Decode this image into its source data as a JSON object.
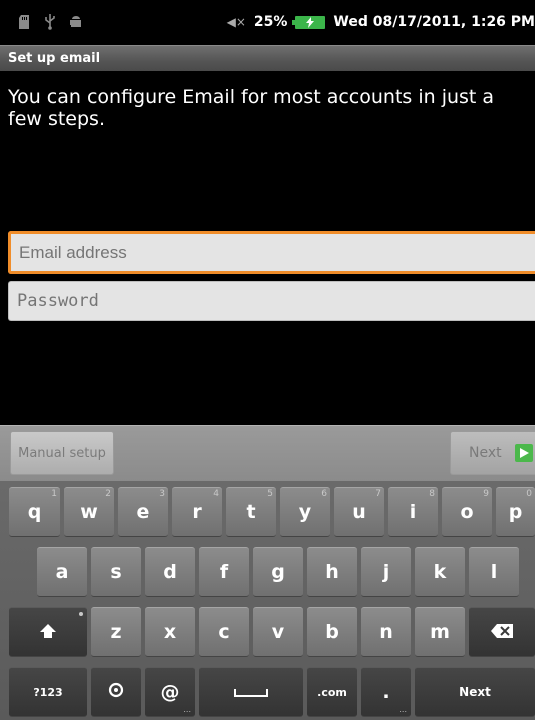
{
  "status_bar": {
    "volume_text": "25%",
    "datetime": "Wed 08/17/2011, 1:26 PM",
    "icons": [
      "sd-card-icon",
      "usb-icon",
      "android-debug-icon",
      "mute-icon",
      "battery-charging-icon"
    ]
  },
  "title_bar": {
    "title": "Set up email"
  },
  "intro": {
    "text": "You can configure Email for most accounts in just a few steps."
  },
  "form": {
    "email": {
      "placeholder": "Email address",
      "value": ""
    },
    "password": {
      "placeholder": "Password",
      "value": ""
    }
  },
  "actions": {
    "manual_setup_label": "Manual setup",
    "next_label": "Next"
  },
  "keyboard": {
    "row1": [
      {
        "label": "q",
        "hint": "1"
      },
      {
        "label": "w",
        "hint": "2"
      },
      {
        "label": "e",
        "hint": "3"
      },
      {
        "label": "r",
        "hint": "4"
      },
      {
        "label": "t",
        "hint": "5"
      },
      {
        "label": "y",
        "hint": "6"
      },
      {
        "label": "u",
        "hint": "7"
      },
      {
        "label": "i",
        "hint": "8"
      },
      {
        "label": "o",
        "hint": "9"
      },
      {
        "label": "p",
        "hint": "0"
      }
    ],
    "row2": [
      "a",
      "s",
      "d",
      "f",
      "g",
      "h",
      "j",
      "k",
      "l"
    ],
    "row3": [
      "z",
      "x",
      "c",
      "v",
      "b",
      "n",
      "m"
    ],
    "symbols_label": "?123",
    "at_label": "@",
    "dotcom_label": ".com",
    "period_label": ".",
    "next_label": "Next",
    "dots_label": "..."
  },
  "colors": {
    "accent_focus": "#f08d2a",
    "battery": "#3bb54a",
    "next_arrow": "#4bb84b"
  }
}
